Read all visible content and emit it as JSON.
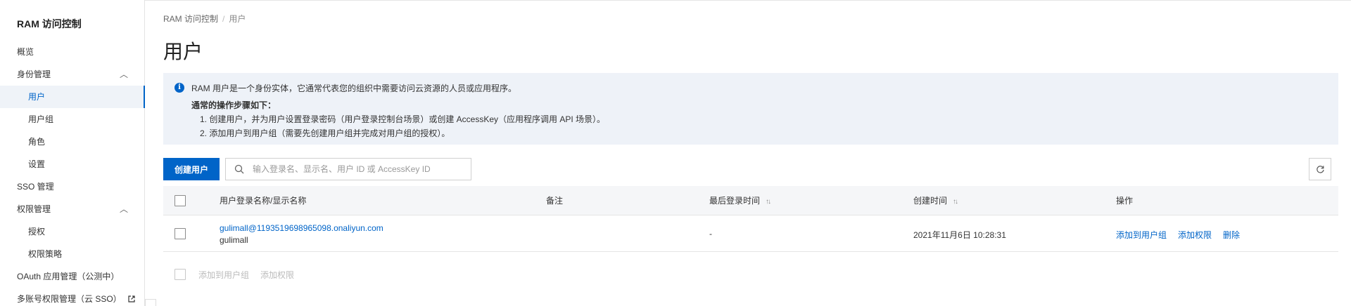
{
  "sidebar": {
    "title": "RAM 访问控制",
    "items": [
      {
        "label": "概览"
      },
      {
        "label": "身份管理",
        "chevron": "︿"
      },
      {
        "label": "用户"
      },
      {
        "label": "用户组"
      },
      {
        "label": "角色"
      },
      {
        "label": "设置"
      },
      {
        "label": "SSO 管理"
      },
      {
        "label": "权限管理",
        "chevron": "︿"
      },
      {
        "label": "授权"
      },
      {
        "label": "权限策略"
      },
      {
        "label": "OAuth 应用管理（公测中）"
      },
      {
        "label": "多账号权限管理（云 SSO）",
        "icon": "external-link-icon"
      }
    ]
  },
  "breadcrumb": {
    "root": "RAM 访问控制",
    "separator": "/",
    "current": "用户"
  },
  "page": {
    "title": "用户"
  },
  "notice": {
    "icon": "info-icon",
    "line1": "RAM 用户是一个身份实体，它通常代表您的组织中需要访问云资源的人员或应用程序。",
    "heading": "通常的操作步骤如下：",
    "step1": "1. 创建用户，并为用户设置登录密码（用户登录控制台场景）或创建 AccessKey（应用程序调用 API 场景）。",
    "step2": "2. 添加用户到用户组（需要先创建用户组并完成对用户组的授权）。"
  },
  "toolbar": {
    "create_label": "创建用户",
    "search_placeholder": "输入登录名、显示名、用户 ID 或 AccessKey ID"
  },
  "table": {
    "headers": {
      "name": "用户登录名称/显示名称",
      "note": "备注",
      "last_login": "最后登录时间",
      "created": "创建时间",
      "actions": "操作"
    },
    "sort_glyph": "↑↓",
    "rows": [
      {
        "login_name": "gulimall@1193519698965098.onaliyun.com",
        "display_name": "gulimall",
        "note": "",
        "last_login": "-",
        "created": "2021年11月6日 10:28:31",
        "action_add_group": "添加到用户组",
        "action_add_permission": "添加权限",
        "action_delete": "删除"
      }
    ]
  },
  "batch": {
    "add_group": "添加到用户组",
    "add_permission": "添加权限"
  },
  "colors": {
    "primary": "#0064c8",
    "accent": "#ff6a00",
    "notice_bg": "#eef2f8"
  }
}
